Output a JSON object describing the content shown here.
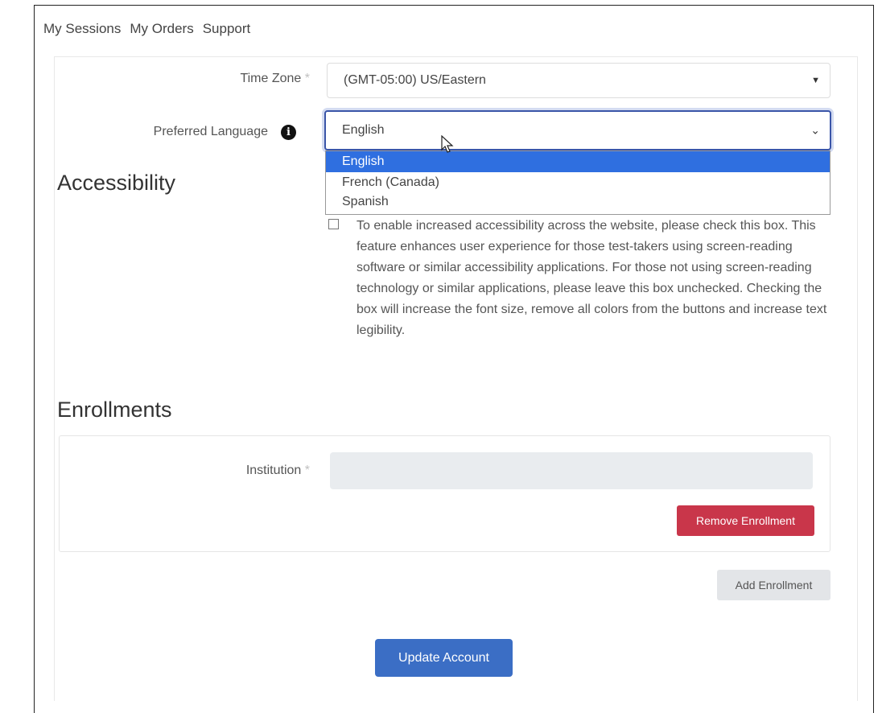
{
  "nav": {
    "items": [
      "My Sessions",
      "My Orders",
      "Support"
    ]
  },
  "time_zone": {
    "label": "Time Zone",
    "required_mark": "*",
    "value": "(GMT-05:00) US/Eastern"
  },
  "preferred_language": {
    "label": "Preferred Language",
    "info_icon": "info-circle-icon",
    "value": "English",
    "options": [
      "English",
      "French (Canada)",
      "Spanish"
    ],
    "selected_option": "English"
  },
  "accessibility": {
    "heading": "Accessibility",
    "checked": false,
    "description": "To enable increased accessibility across the website, please check this box. This feature enhances user experience for those test-takers using screen-reading software or similar accessibility applications. For those not using screen-reading technology or similar applications, please leave this box unchecked. Checking the box will increase the font size, remove all colors from the buttons and increase text legibility."
  },
  "enrollments": {
    "heading": "Enrollments",
    "institution_label": "Institution",
    "required_mark": "*",
    "institution_value": "",
    "remove_button": "Remove Enrollment",
    "add_button": "Add Enrollment"
  },
  "update_button": "Update Account",
  "colors": {
    "remove": "#c9364a",
    "update": "#3b6ec5",
    "dropdown_highlight": "#2f6fe0",
    "focus_border": "#3a55a8"
  }
}
